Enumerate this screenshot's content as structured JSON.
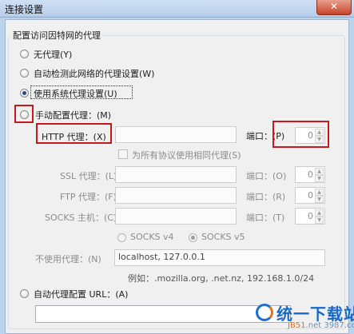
{
  "window": {
    "title": "连接设置",
    "close_glyph": "✕"
  },
  "group": {
    "title": "配置访问因特网的代理"
  },
  "modes": [
    {
      "label": "无代理(Y)",
      "checked": false
    },
    {
      "label": "自动检测此网络的代理设置(W)",
      "checked": false
    },
    {
      "label": "使用系统代理设置(U)",
      "checked": true
    },
    {
      "label": "手动配置代理：(M)",
      "checked": false
    }
  ],
  "proxies": [
    {
      "label": "HTTP 代理：(X)",
      "host": "",
      "port_label": "端口：(P)",
      "port": "0"
    },
    {
      "label": "SSL 代理：(L)",
      "host": "",
      "port_label": "端口：(O)",
      "port": "0"
    },
    {
      "label": "FTP 代理：(F)",
      "host": "",
      "port_label": "端口：(R)",
      "port": "0"
    },
    {
      "label": "SOCKS 主机：(C)",
      "host": "",
      "port_label": "端口：(T)",
      "port": "0"
    }
  ],
  "same_proxy": {
    "label": "为所有协议使用相同代理(S)",
    "checked": false
  },
  "socks": {
    "v4_label": "SOCKS v4",
    "v5_label": "SOCKS v5",
    "selected": "v5"
  },
  "no_proxy": {
    "label": "不使用代理：(N)",
    "value": "localhost, 127.0.0.1",
    "example": "例如：.mozilla.org, .net.nz, 192.168.1.0/24"
  },
  "auto_config": {
    "label": "自动代理配置 URL：(A)",
    "value": ""
  },
  "watermark": {
    "text": "统一下载站",
    "sub_a": "JB51",
    "sub_b": ".net",
    "sub_c": "3987.com"
  },
  "colors": {
    "highlight": "#c8171d",
    "selected_radio": "#2b4a84"
  }
}
